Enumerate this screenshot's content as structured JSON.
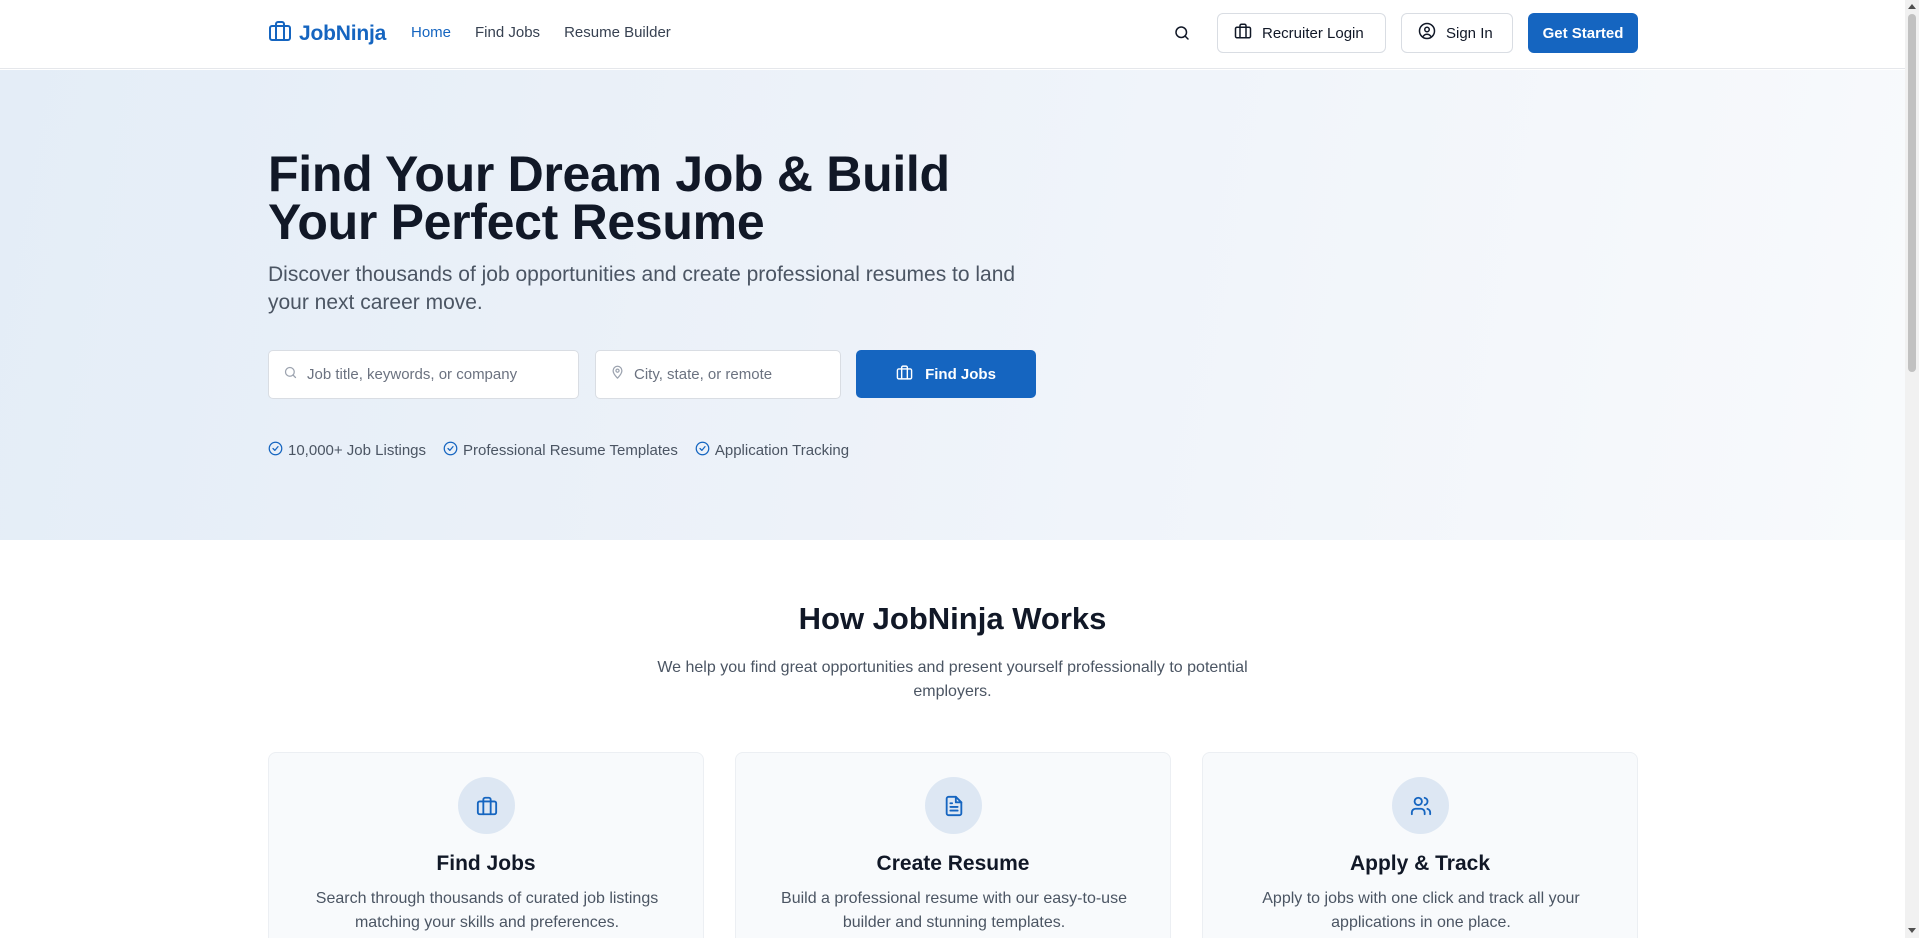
{
  "header": {
    "logo_text": "JobNinja",
    "nav": [
      {
        "label": "Home",
        "active": true
      },
      {
        "label": "Find Jobs",
        "active": false
      },
      {
        "label": "Resume Builder",
        "active": false
      }
    ],
    "recruiter_label": "Recruiter Login",
    "signin_label": "Sign In",
    "get_started_label": "Get Started"
  },
  "hero": {
    "title": "Find Your Dream Job & Build Your Perfect Resume",
    "subtitle": "Discover thousands of job opportunities and create professional resumes to land your next career move.",
    "job_placeholder": "Job title, keywords, or company",
    "location_placeholder": "City, state, or remote",
    "find_button": "Find Jobs",
    "features": [
      "10,000+ Job Listings",
      "Professional Resume Templates",
      "Application Tracking"
    ]
  },
  "how": {
    "title": "How JobNinja Works",
    "subtitle": "We help you find great opportunities and present yourself professionally to potential employers.",
    "cards": [
      {
        "icon": "briefcase-icon",
        "title": "Find Jobs",
        "text": "Search through thousands of curated job listings matching your skills and preferences."
      },
      {
        "icon": "document-icon",
        "title": "Create Resume",
        "text": "Build a professional resume with our easy-to-use builder and stunning templates."
      },
      {
        "icon": "users-icon",
        "title": "Apply & Track",
        "text": "Apply to jobs with one click and track all your applications in one place."
      }
    ]
  },
  "colors": {
    "brand": "#1565c0",
    "hero_bg": "#e4edf7",
    "card_bg": "#f8fafc",
    "icon_bg": "#dde7f3"
  }
}
